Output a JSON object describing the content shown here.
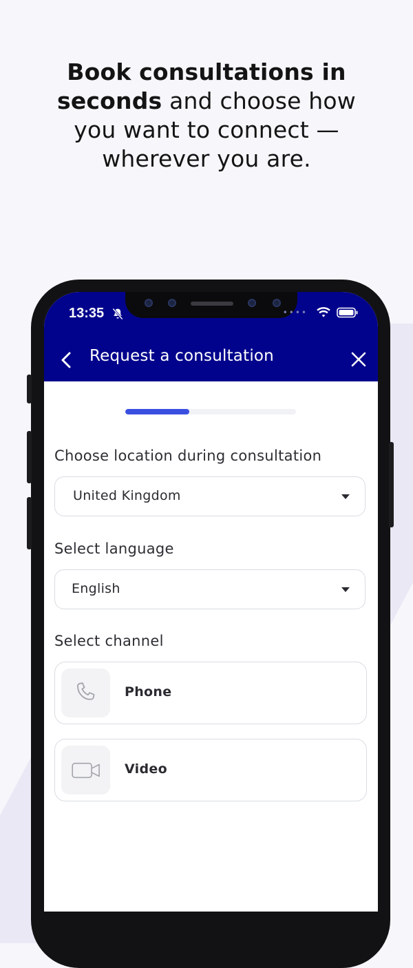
{
  "marketing": {
    "headline_bold_1": "Book consultations in",
    "headline_bold_2": "seconds",
    "headline_rest_1": " and choose how",
    "headline_rest_2": "you want to connect —",
    "headline_rest_3": "wherever you are."
  },
  "status_bar": {
    "time": "13:35",
    "icons": [
      "bell-slash-icon",
      "wifi-icon",
      "battery-icon"
    ]
  },
  "header": {
    "title": "Request a consultation",
    "back_icon": "chevron-left-icon",
    "close_icon": "close-icon",
    "background_color": "#02038c"
  },
  "progress": {
    "fraction": 0.375,
    "color": "#3a4fe0"
  },
  "form": {
    "location": {
      "label": "Choose location during consultation",
      "value": "United Kingdom"
    },
    "language": {
      "label": "Select language",
      "value": "English"
    },
    "channel": {
      "label": "Select channel",
      "options": [
        {
          "name": "Phone",
          "icon": "phone-icon"
        },
        {
          "name": "Video",
          "icon": "video-camera-icon"
        }
      ]
    }
  }
}
